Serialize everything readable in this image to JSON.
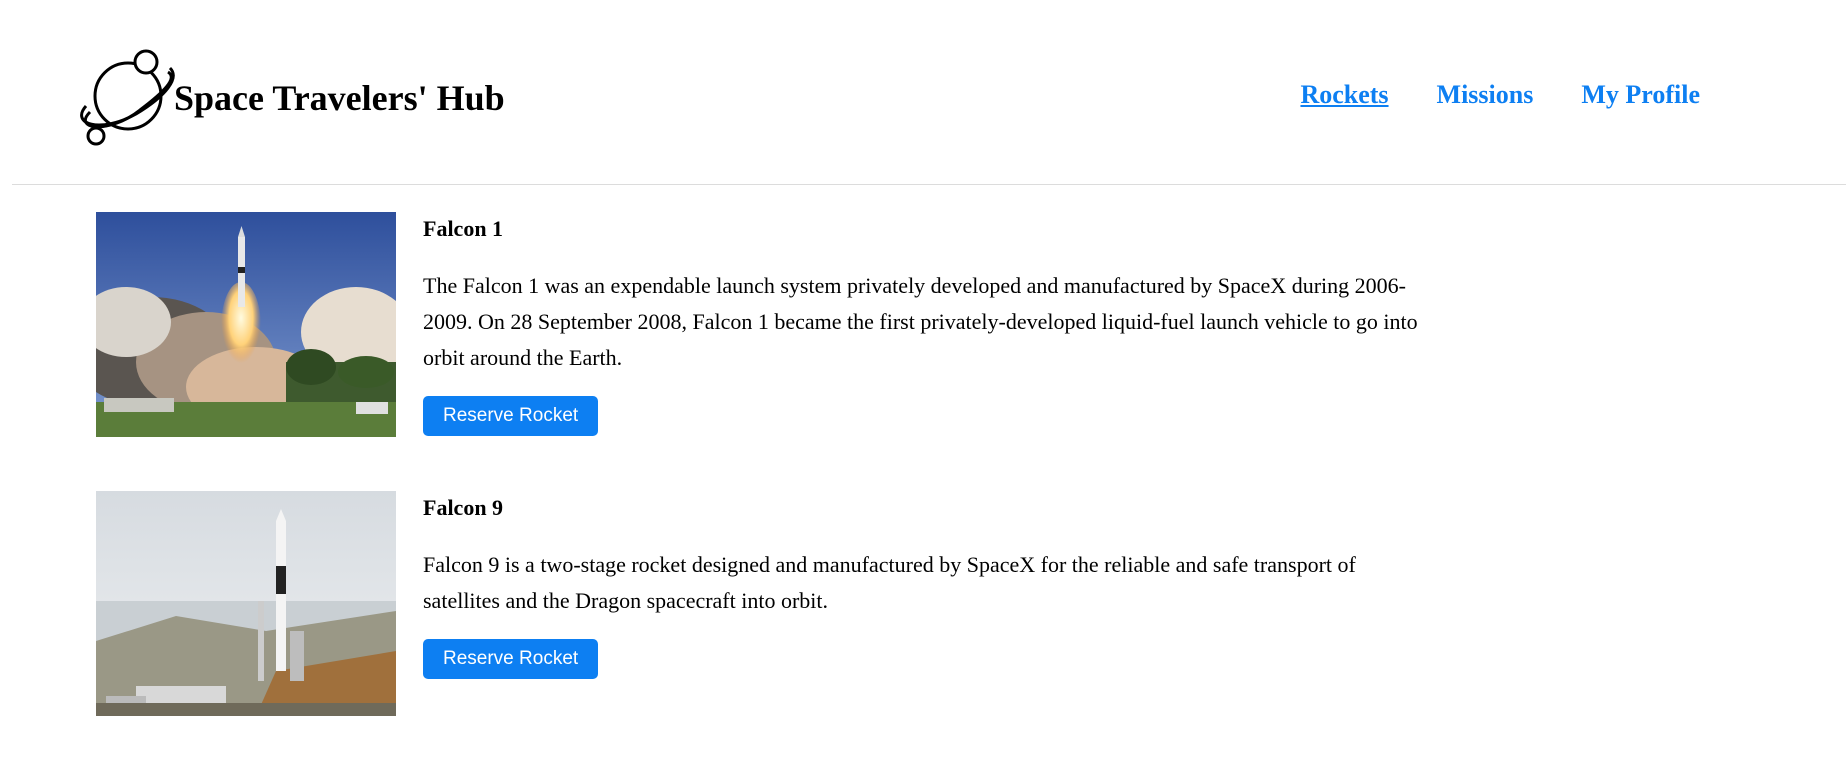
{
  "brand": {
    "title": "Space Travelers' Hub",
    "logo_icon": "planet-logo-icon"
  },
  "nav": {
    "items": [
      {
        "label": "Rockets",
        "active": true
      },
      {
        "label": "Missions",
        "active": false
      },
      {
        "label": "My Profile",
        "active": false
      }
    ]
  },
  "colors": {
    "accent": "#0d7ff2",
    "divider": "#dcdcdc"
  },
  "rockets": [
    {
      "name": "Falcon 1",
      "description": "The Falcon 1 was an expendable launch system privately developed and manufactured by SpaceX during 2006-2009. On 28 September 2008, Falcon 1 became the first privately-developed liquid-fuel launch vehicle to go into orbit around the Earth.",
      "button": "Reserve Rocket",
      "image": "rocket-launch-photo"
    },
    {
      "name": "Falcon 9",
      "description": "Falcon 9 is a two-stage rocket designed and manufactured by SpaceX for the reliable and safe transport of satellites and the Dragon spacecraft into orbit.",
      "button": "Reserve Rocket",
      "image": "rocket-on-pad-photo"
    }
  ]
}
